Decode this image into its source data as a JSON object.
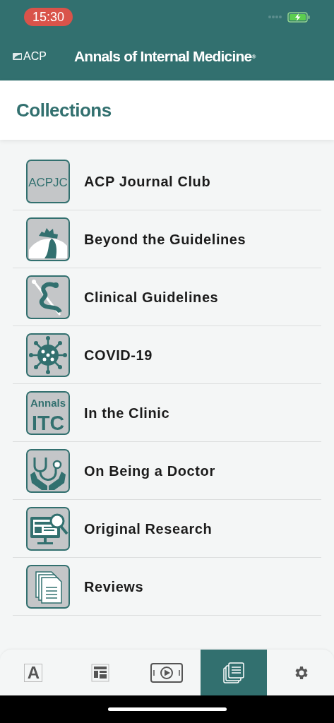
{
  "status_bar": {
    "time": "15:30"
  },
  "header": {
    "logo": "ACP",
    "title": "Annals of Internal Medicine",
    "mark": "®"
  },
  "page": {
    "title": "Collections"
  },
  "collections": [
    {
      "label": "ACP Journal Club",
      "icon_text": "ACPJC"
    },
    {
      "label": "Beyond the Guidelines"
    },
    {
      "label": "Clinical Guidelines"
    },
    {
      "label": "COVID-19"
    },
    {
      "label": "In the Clinic",
      "icon_text": "Annals",
      "icon_text_2": "ITC"
    },
    {
      "label": "On Being a Doctor"
    },
    {
      "label": "Original Research"
    },
    {
      "label": "Reviews"
    }
  ],
  "tabs": [
    {
      "selected": false,
      "glyph": "A"
    },
    {
      "selected": false
    },
    {
      "selected": false
    },
    {
      "selected": true
    },
    {
      "selected": false
    }
  ]
}
